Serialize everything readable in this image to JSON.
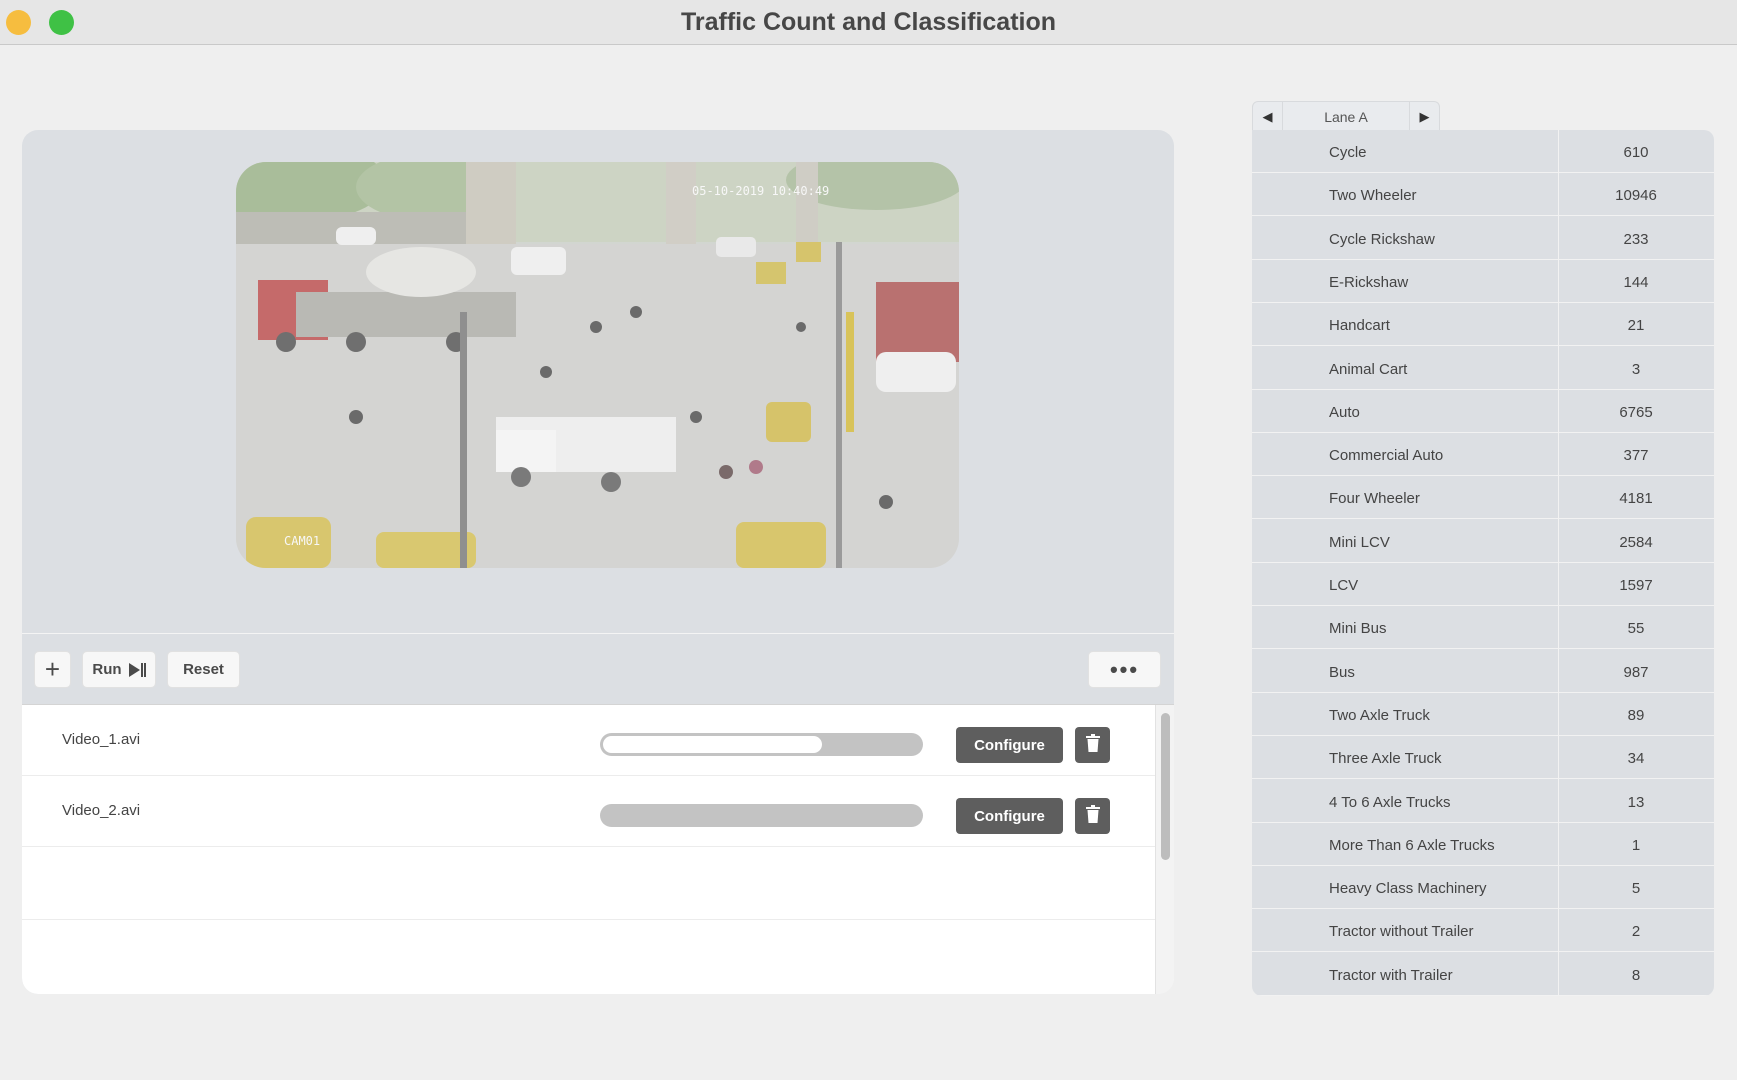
{
  "window": {
    "title": "Traffic Count and Classification"
  },
  "video": {
    "timestamp": "05-10-2019 10:40:49",
    "camera_label": "CAM01"
  },
  "toolbar": {
    "add_symbol": "+",
    "run_label": "Run",
    "reset_label": "Reset",
    "more_symbol": "•••"
  },
  "files": [
    {
      "name": "Video_1.avi",
      "progress": 0.69,
      "configure_label": "Configure"
    },
    {
      "name": "Video_2.avi",
      "progress": 0.0,
      "configure_label": "Configure"
    }
  ],
  "lane": {
    "current": "Lane A",
    "prev_symbol": "◀",
    "next_symbol": "▶"
  },
  "counts": [
    {
      "name": "Cycle",
      "value": "610"
    },
    {
      "name": "Two Wheeler",
      "value": "10946"
    },
    {
      "name": "Cycle Rickshaw",
      "value": "233"
    },
    {
      "name": "E-Rickshaw",
      "value": "144"
    },
    {
      "name": "Handcart",
      "value": "21"
    },
    {
      "name": "Animal Cart",
      "value": "3"
    },
    {
      "name": "Auto",
      "value": "6765"
    },
    {
      "name": "Commercial Auto",
      "value": "377"
    },
    {
      "name": "Four Wheeler",
      "value": "4181"
    },
    {
      "name": "Mini LCV",
      "value": "2584"
    },
    {
      "name": "LCV",
      "value": "1597"
    },
    {
      "name": "Mini Bus",
      "value": "55"
    },
    {
      "name": "Bus",
      "value": "987"
    },
    {
      "name": "Two Axle Truck",
      "value": "89"
    },
    {
      "name": "Three Axle Truck",
      "value": "34"
    },
    {
      "name": "4 To 6 Axle Trucks",
      "value": "13"
    },
    {
      "name": "More Than 6 Axle Trucks",
      "value": "1"
    },
    {
      "name": "Heavy Class Machinery",
      "value": "5"
    },
    {
      "name": "Tractor without Trailer",
      "value": "2"
    },
    {
      "name": "Tractor with Trailer",
      "value": "8"
    }
  ],
  "colors": {
    "window_close": "#f6bd3f",
    "window_zoom": "#3fc145",
    "button_dark": "#5e5e5e",
    "panel": "#dcdfe3"
  },
  "icons": [
    "plus-icon",
    "play-step-icon",
    "more-icon",
    "trash-icon",
    "arrow-left-icon",
    "arrow-right-icon"
  ]
}
